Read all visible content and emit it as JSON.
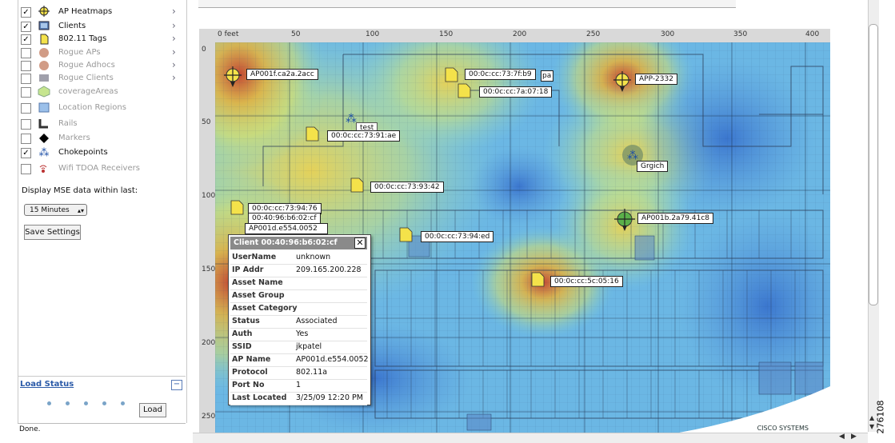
{
  "layers": [
    {
      "label": "AP Heatmaps",
      "checked": true,
      "enabled": true,
      "icon": "ap-heatmap-icon",
      "has_arrow": true
    },
    {
      "label": "Clients",
      "checked": true,
      "enabled": true,
      "icon": "clients-icon",
      "has_arrow": true
    },
    {
      "label": "802.11 Tags",
      "checked": true,
      "enabled": true,
      "icon": "tags-icon",
      "has_arrow": true
    },
    {
      "label": "Rogue APs",
      "checked": false,
      "enabled": false,
      "icon": "rogue-ap-icon",
      "has_arrow": true
    },
    {
      "label": "Rogue Adhocs",
      "checked": false,
      "enabled": false,
      "icon": "rogue-adhoc-icon",
      "has_arrow": true
    },
    {
      "label": "Rogue Clients",
      "checked": false,
      "enabled": false,
      "icon": "rogue-client-icon",
      "has_arrow": true
    },
    {
      "label": "coverageAreas",
      "checked": false,
      "enabled": false,
      "icon": "coverage-area-icon",
      "has_arrow": false
    },
    {
      "label": "Location Regions",
      "checked": false,
      "enabled": false,
      "icon": "location-region-icon",
      "has_arrow": false
    },
    {
      "label": "Rails",
      "checked": false,
      "enabled": false,
      "icon": "rails-icon",
      "has_arrow": false
    },
    {
      "label": "Markers",
      "checked": false,
      "enabled": false,
      "icon": "marker-icon",
      "has_arrow": false
    },
    {
      "label": "Chokepoints",
      "checked": true,
      "enabled": true,
      "icon": "chokepoint-icon",
      "has_arrow": false
    },
    {
      "label": "Wifi TDOA Receivers",
      "checked": false,
      "enabled": false,
      "icon": "tdoa-receiver-icon",
      "has_arrow": false
    }
  ],
  "mse_label": "Display MSE data within last:",
  "time_select": "15 Minutes",
  "save_label": "Save Settings",
  "load_status_title": "Load Status",
  "collapse_symbol": "−",
  "load_label": "Load",
  "status_text": "Done.",
  "ruler": {
    "x_ticks": [
      "0 feet",
      "50",
      "100",
      "150",
      "200",
      "250",
      "300",
      "350",
      "400"
    ],
    "y_ticks": [
      "0",
      "50",
      "100",
      "150",
      "200",
      "250"
    ]
  },
  "map_labels": {
    "ap1": "AP001f.ca2a.2acc",
    "client_7f": "00:0c:cc:73:7f:b9",
    "client_7f_hidden": "pa",
    "client_7a": "00:0c:cc:7a:07:18",
    "app": "APP-2332",
    "test": "test",
    "client_91": "00:0c:cc:73:91:ae",
    "grgich": "Grgich",
    "client_93": "00:0c:cc:73:93:42",
    "client_94": "00:0c:cc:73:94:76",
    "client_b6": "00:40:96:b6:02:cf",
    "ap_hidden": "AP001d.e554.0052",
    "ap2": "AP001b.2a79.41c8",
    "client_ed": "00:0c:cc:73:94:ed",
    "client_5c": "00:0c:cc:5c:05:16",
    "watermark": "CISCO SYSTEMS"
  },
  "popup": {
    "title": "Client 00:40:96:b6:02:cf",
    "rows": [
      {
        "label": "UserName",
        "value": "unknown"
      },
      {
        "label": "IP Addr",
        "value": "209.165.200.228"
      },
      {
        "label": "Asset Name",
        "value": ""
      },
      {
        "label": "Asset Group",
        "value": ""
      },
      {
        "label": "Asset Category",
        "value": ""
      },
      {
        "label": "Status",
        "value": "Associated"
      },
      {
        "label": "Auth",
        "value": "Yes"
      },
      {
        "label": "SSID",
        "value": "jkpatel"
      },
      {
        "label": "AP Name",
        "value": "AP001d.e554.0052"
      },
      {
        "label": "Protocol",
        "value": "802.11a"
      },
      {
        "label": "Port No",
        "value": "1"
      },
      {
        "label": "Last Located",
        "value": "3/25/09 12:20 PM"
      }
    ]
  },
  "figure_id": "276108"
}
